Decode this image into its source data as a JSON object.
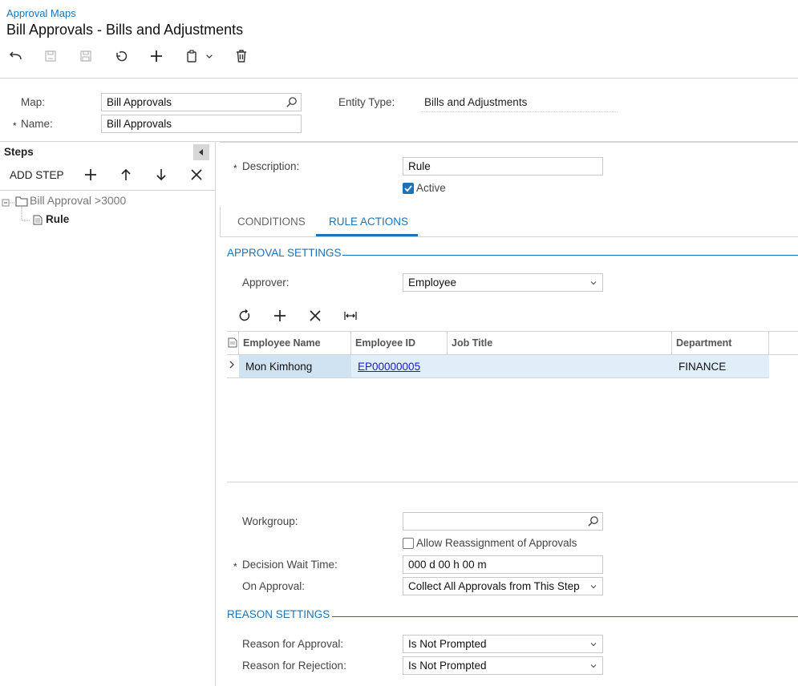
{
  "header": {
    "breadcrumb": "Approval Maps",
    "title": "Bill Approvals - Bills and Adjustments"
  },
  "toolbar": {
    "icons": [
      "back-icon",
      "save-close-icon",
      "save-icon",
      "undo-icon",
      "add-icon",
      "copy-icon",
      "chevron-down-icon",
      "delete-icon"
    ]
  },
  "summary": {
    "map_label": "Map:",
    "map_value": "Bill Approvals",
    "name_label": "Name:",
    "name_value": "Bill Approvals",
    "entity_type_label": "Entity Type:",
    "entity_type_value": "Bills and Adjustments",
    "required_mark": "*"
  },
  "steps": {
    "title": "Steps",
    "add_step_label": "ADD STEP",
    "tree": [
      {
        "label": "Bill Approval >3000"
      },
      {
        "label": "Rule"
      }
    ]
  },
  "rule": {
    "description_label": "Description:",
    "description_value": "Rule",
    "active_label": "Active",
    "active": true
  },
  "tabs": [
    {
      "label": "CONDITIONS",
      "active": false
    },
    {
      "label": "RULE ACTIONS",
      "active": true
    }
  ],
  "approval_settings": {
    "section_title": "APPROVAL SETTINGS",
    "approver_label": "Approver:",
    "approver_value": "Employee",
    "grid": {
      "columns": [
        "Employee Name",
        "Employee ID",
        "Job Title",
        "Department"
      ],
      "rows": [
        {
          "employee_name": "Mon Kimhong",
          "employee_id": "EP00000005",
          "job_title": "",
          "department": "FINANCE"
        }
      ]
    },
    "workgroup_label": "Workgroup:",
    "workgroup_value": "",
    "allow_reassignment_label": "Allow Reassignment of Approvals",
    "allow_reassignment": false,
    "decision_wait_label": "Decision Wait Time:",
    "decision_wait_value": "000 d 00 h 00 m",
    "on_approval_label": "On Approval:",
    "on_approval_value": "Collect All Approvals from This Step"
  },
  "reason_settings": {
    "section_title": "REASON SETTINGS",
    "approval_label": "Reason for Approval:",
    "approval_value": "Is Not Prompted",
    "rejection_label": "Reason for Rejection:",
    "rejection_value": "Is Not Prompted"
  },
  "colors": {
    "accent": "#1a73b8",
    "selected_row": "#e0eef9",
    "link": "#1a1ac8"
  }
}
